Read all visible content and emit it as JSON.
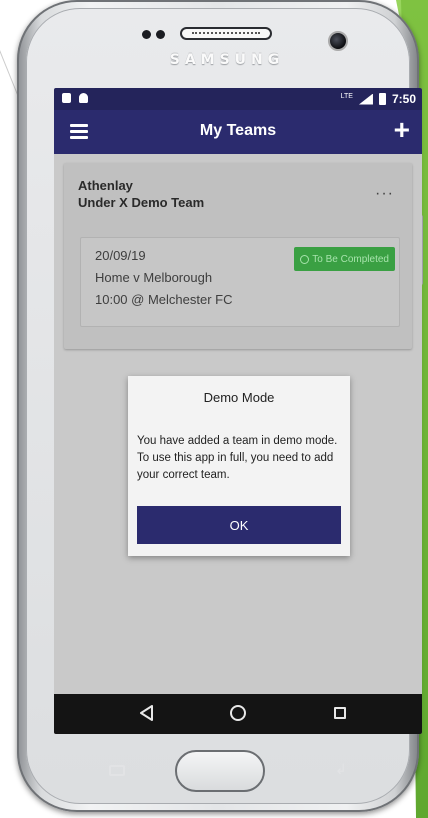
{
  "device": {
    "brand": "SAMSUNG"
  },
  "status_bar": {
    "time": "7:50",
    "network_label": "LTE"
  },
  "app_bar": {
    "title": "My Teams",
    "menu_icon": "hamburger-menu-icon",
    "add_icon": "plus-icon"
  },
  "team": {
    "club": "Athenlay",
    "name": "Under X Demo Team",
    "more_icon": "ellipsis-icon",
    "fixture": {
      "date": "20/09/19",
      "match": "Home v Melborough",
      "time_venue": "10:00 @ Melchester FC",
      "status": "To Be Completed",
      "status_color": "#3aa043"
    }
  },
  "dialog": {
    "title": "Demo Mode",
    "message": "You have added a team in demo mode. To use this app in full, you need to add your correct team.",
    "ok_label": "OK"
  },
  "nav": {
    "back_icon": "triangle-back-icon",
    "home_icon": "circle-home-icon",
    "recent_icon": "square-recent-icon"
  },
  "colors": {
    "primary": "#2b2b6e",
    "status_bar": "#24245b",
    "accent_green": "#3aa043"
  }
}
